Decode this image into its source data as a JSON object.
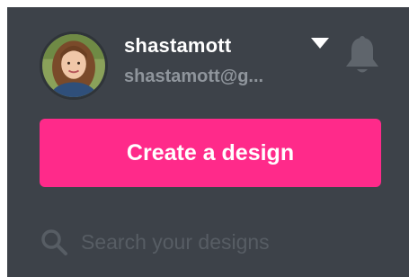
{
  "account": {
    "username": "shastamott",
    "email": "shastamott@g..."
  },
  "actions": {
    "create_label": "Create a design"
  },
  "search": {
    "placeholder": "Search your designs",
    "value": ""
  },
  "icons": {
    "avatar": "user-avatar-photo",
    "dropdown": "caret-down-icon",
    "notifications": "bell-icon",
    "search": "search-icon"
  },
  "colors": {
    "panel_bg": "#3d4249",
    "accent": "#ff2a8a",
    "text_primary": "#ffffff",
    "text_muted": "#8f959c",
    "placeholder": "#575d64"
  }
}
